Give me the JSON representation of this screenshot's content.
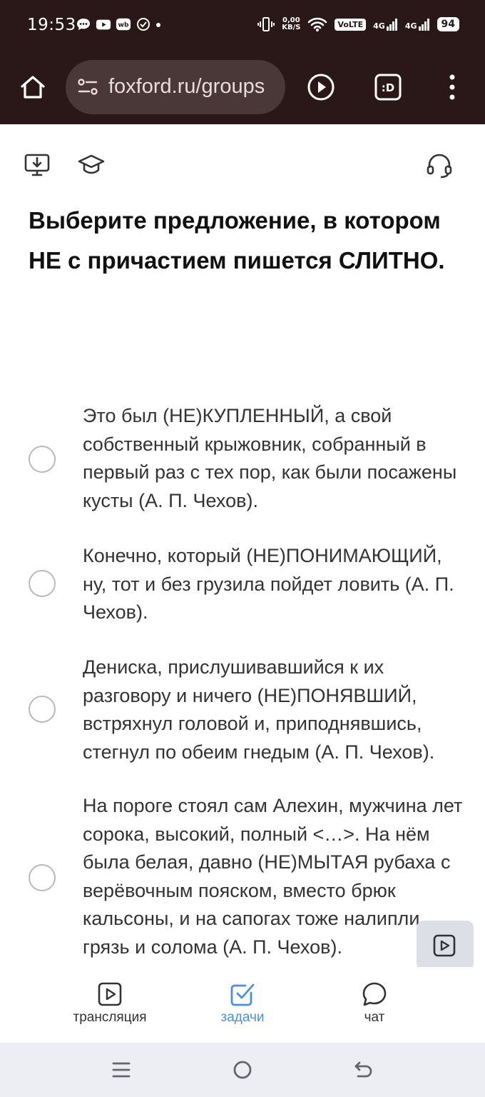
{
  "status_bar": {
    "time": "19:53",
    "net_speed_value": "0,00",
    "net_speed_unit": "KB/S",
    "volte": "VoLTE",
    "sim1": "4G",
    "sim2": "4G",
    "battery": "94"
  },
  "browser": {
    "url": "foxford.ru/groups"
  },
  "question": {
    "text": "Выберите предложение, в котором НЕ с причастием пишется СЛИТНО."
  },
  "options": [
    {
      "text": "Это был (НЕ)КУПЛЕННЫЙ, а свой собственный крыжовник, собранный в первый раз с тех пор, как были посажены кусты (А. П. Чехов)."
    },
    {
      "text": "Конечно, который (НЕ)ПОНИМАЮЩИЙ, ну, тот и без грузила пойдет ловить (А. П. Чехов)."
    },
    {
      "text": "Дениска, прислушивавшийся к их разговору и ничего (НЕ)ПОНЯВШИЙ, встряхнул головой и, приподнявшись, стегнул по обеим гнедым (А. П. Чехов)."
    },
    {
      "text": "На пороге стоял сам Алехин, мужчина лет сорока, высокий, полный <…>. На нём была белая, давно (НЕ)МЫТАЯ рубаха с верёвочным пояском, вместо брюк кальсоны, и на сапогах тоже налипли грязь и солома (А. П. Чехов)."
    }
  ],
  "tabs": [
    {
      "label": "трансляция",
      "icon": "play-square-icon"
    },
    {
      "label": "задачи",
      "icon": "check-square-icon",
      "active": true
    },
    {
      "label": "чат",
      "icon": "chat-bubble-icon"
    }
  ],
  "colors": {
    "status_bg": "#2a1818",
    "url_bg": "#4a3838",
    "accent": "#4a8fe0"
  }
}
